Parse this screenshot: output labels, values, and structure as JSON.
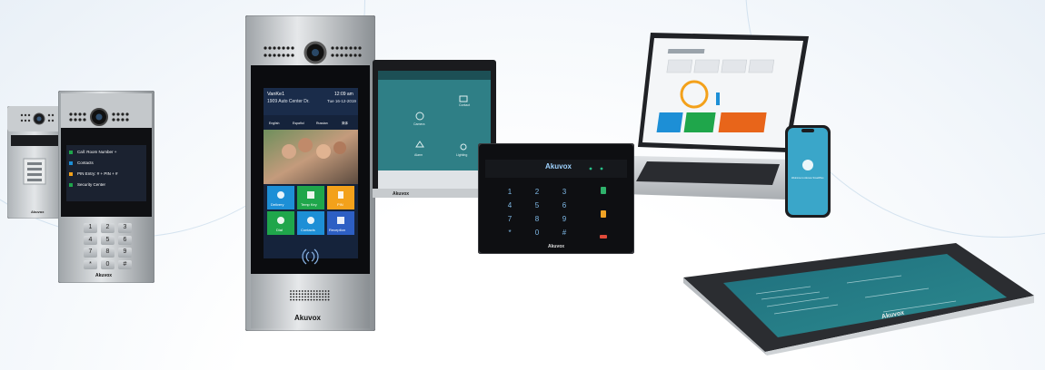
{
  "colors": {
    "brand_blue": "#1d8fd6",
    "tile_orange": "#f3a11b",
    "tile_green": "#1fa64b",
    "screen_teal": "#2f7f86",
    "panel_silver": "#c7cbce",
    "glass_black": "#0e0f12"
  },
  "door_phone_main": {
    "name": "VanKe1",
    "address": "1909 Auto Center Dr.",
    "time": "12:09 am",
    "date": "Tue 16-12-2019",
    "languages": [
      "English",
      "Español",
      "Russian",
      "简体"
    ],
    "tiles": [
      "Delivery",
      "Temp Key",
      "PIN",
      "Dial",
      "Contacts",
      "Reception"
    ],
    "brand": "Akuvox"
  },
  "door_phone_keypad": {
    "menu": [
      "Call: Room Number +",
      "Contacts",
      "PIN Entry: # + PIN + #",
      "Security Center"
    ],
    "keys": [
      "1",
      "2",
      "3",
      "4",
      "5",
      "6",
      "7",
      "8",
      "9",
      "*",
      "0",
      "#"
    ],
    "brand": "Akuvox"
  },
  "door_phone_small": {
    "brand": "Akuvox"
  },
  "indoor_monitor": {
    "tiles": [
      "Camera",
      "Contact",
      "Alarm",
      "Lighting"
    ],
    "brand": "Akuvox"
  },
  "access_keypad": {
    "brand": "Akuvox",
    "keys": [
      "1",
      "2",
      "3",
      "4",
      "5",
      "6",
      "7",
      "8",
      "9",
      "*",
      "0",
      "#"
    ]
  },
  "laptop": {},
  "phone": {
    "caption": "Welcome to Akuvox SmartPlus"
  },
  "tablet_monitor": {
    "brand": "Akuvox"
  }
}
